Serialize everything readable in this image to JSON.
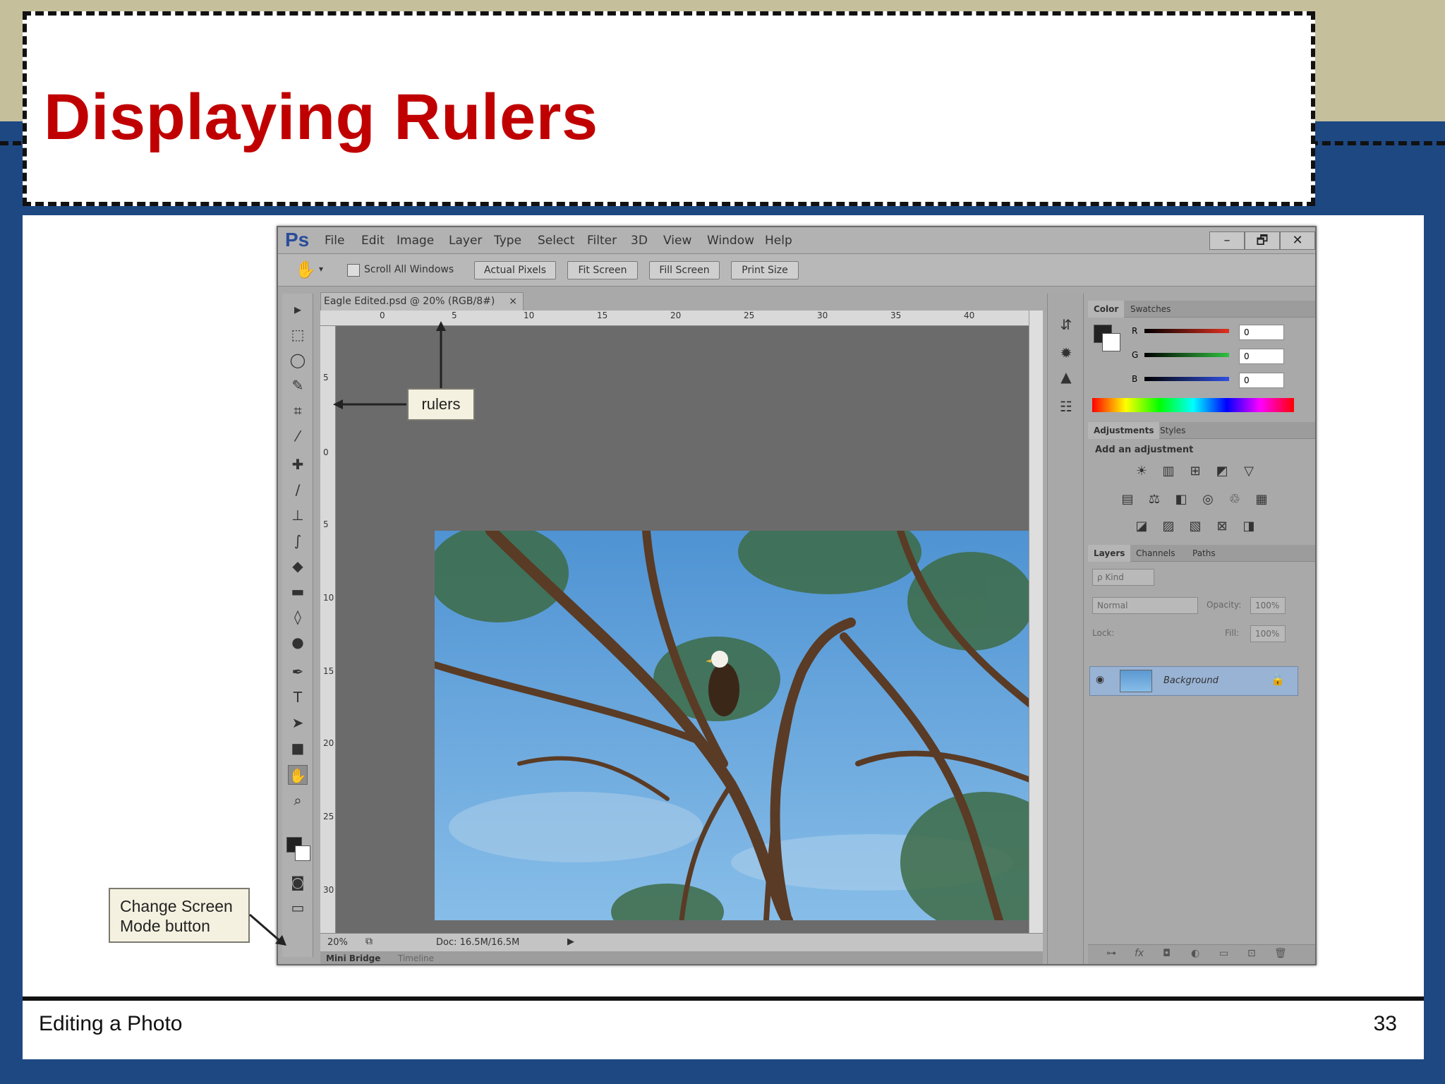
{
  "slide": {
    "title": "Displaying Rulers",
    "footer_left": "Editing a Photo",
    "page_number": "33"
  },
  "ps": {
    "logo": "Ps",
    "menu": [
      "File",
      "Edit",
      "Image",
      "Layer",
      "Type",
      "Select",
      "Filter",
      "3D",
      "View",
      "Window",
      "Help"
    ],
    "window_buttons": [
      "–",
      "🗗",
      "✕"
    ],
    "options": {
      "scroll_all_windows": "Scroll All Windows",
      "actual_pixels": "Actual Pixels",
      "fit_screen": "Fit Screen",
      "fill_screen": "Fill Screen",
      "print_size": "Print Size"
    },
    "doc_tab": "Eagle Edited.psd @ 20% (RGB/8#)",
    "doc_tab_close": "×",
    "ruler_top": [
      "0",
      "5",
      "10",
      "15",
      "20",
      "25",
      "30",
      "35",
      "40"
    ],
    "ruler_left": [
      "5",
      "0",
      "5",
      "10",
      "15",
      "20",
      "25",
      "30"
    ],
    "status": {
      "zoom": "20%",
      "doc": "Doc: 16.5M/16.5M"
    },
    "bridge_tabs": [
      "Mini Bridge",
      "Timeline"
    ],
    "color_panel": {
      "tabs": [
        "Color",
        "Swatches"
      ],
      "channels": [
        "R",
        "G",
        "B"
      ],
      "values": [
        "0",
        "0",
        "0"
      ]
    },
    "adjustments_panel": {
      "tabs": [
        "Adjustments",
        "Styles"
      ],
      "label": "Add an adjustment"
    },
    "layers_panel": {
      "tabs": [
        "Layers",
        "Channels",
        "Paths"
      ],
      "kind": "ρ Kind",
      "blend": "Normal",
      "opacity_label": "Opacity:",
      "opacity": "100%",
      "lock_label": "Lock:",
      "fill_label": "Fill:",
      "fill": "100%",
      "layer_name": "Background"
    }
  },
  "callouts": {
    "rulers": "rulers",
    "change_screen_mode": "Change Screen Mode button"
  }
}
